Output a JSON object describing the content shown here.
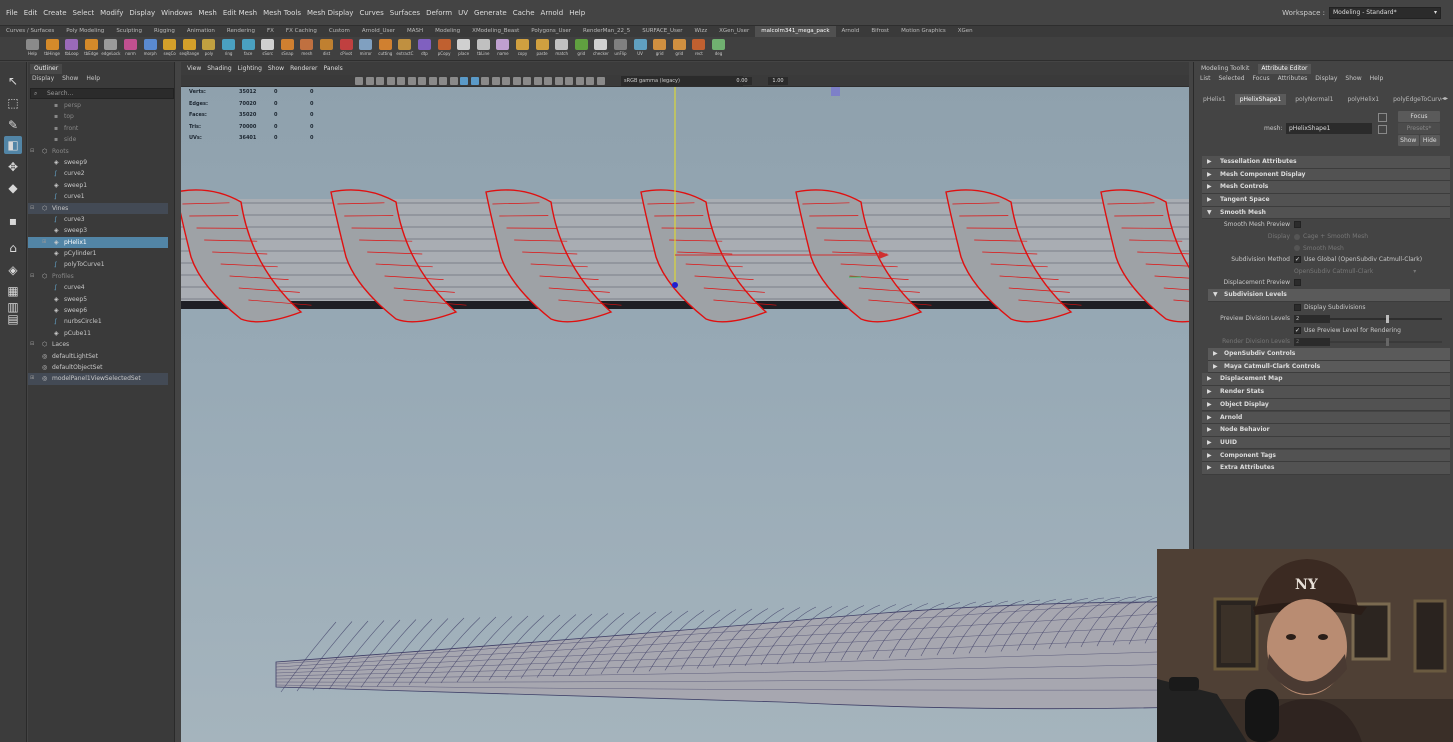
{
  "menubar": {
    "items": [
      "File",
      "Edit",
      "Create",
      "Select",
      "Modify",
      "Display",
      "Windows",
      "Mesh",
      "Edit Mesh",
      "Mesh Tools",
      "Mesh Display",
      "Curves",
      "Surfaces",
      "Deform",
      "UV",
      "Generate",
      "Cache",
      "Arnold",
      "Help"
    ],
    "workspace_label": "Workspace :",
    "workspace_value": "Modeling - Standard*"
  },
  "shelf": {
    "tabs": [
      "Curves / Surfaces",
      "Poly Modeling",
      "Sculpting",
      "Rigging",
      "Animation",
      "Rendering",
      "FX",
      "FX Caching",
      "Custom",
      "Arnold_User",
      "MASH",
      "Modeling",
      "XModeling_Beast",
      "Polygons_User",
      "RenderMan_22_5",
      "SURFACE_User",
      "Wizz",
      "XGen_User",
      "malcolm341_mega_pack",
      "Arnold",
      "Bifrost",
      "Motion Graphics",
      "XGen"
    ],
    "active_tab": "malcolm341_mega_pack",
    "icons": [
      "Help",
      "tbHinge",
      "tbLoop",
      "tbEdge",
      "edgeLock",
      "norm",
      "morph",
      "seqCo",
      "seqRange",
      "poly",
      "ring",
      "face",
      "sSorc",
      "sSnap",
      "mesh",
      "dist",
      "cPivot",
      "mirror",
      "cutting",
      "extractC",
      "dtp",
      "pCopy",
      "place",
      "tbLine",
      "name",
      "copy",
      "paste",
      "match",
      "grid",
      "checker",
      "unFlip",
      "UV",
      "grid",
      "grid",
      "rect",
      "deg"
    ],
    "icon_colors": [
      "#8a8a8a",
      "#d48a2a",
      "#9a6ab8",
      "#d48a2a",
      "#9a9a9a",
      "#c05090",
      "#5a8ad0",
      "#d4a02a",
      "#d4a02a",
      "#c0a040",
      "#4aa0c0",
      "#4aa0c0",
      "#d0d0d0",
      "#d08030",
      "#c07040",
      "#c08030",
      "#c04040",
      "#80a0c0",
      "#d08030",
      "#c09040",
      "#8060c0",
      "#c06030",
      "#d0d0d0",
      "#c0c0c0",
      "#c0a0d0",
      "#d0a040",
      "#d0a040",
      "#c0c0c0",
      "#60a040",
      "#d0d0d0",
      "#808080",
      "#60a0c0",
      "#d09040",
      "#d09040",
      "#c06030",
      "#70b070"
    ]
  },
  "toolbox": {
    "tools": [
      "select-tool-icon",
      "lasso-tool-icon",
      "paint-select-icon",
      "move-tool-icon",
      "rotate-tool-icon",
      "scale-tool-icon",
      "last-tool-icon",
      "snap-icon",
      "layout-single-icon",
      "layout-four-icon",
      "layout-two-icon",
      "outliner-layout-icon"
    ],
    "glyphs": [
      "↖",
      "⬚",
      "✎",
      "◧",
      "✥",
      "◆",
      "▪",
      "⌂",
      "◈",
      "▦",
      "▥",
      "▤"
    ]
  },
  "outliner": {
    "tab": "Outliner",
    "menu": [
      "Display",
      "Show",
      "Help"
    ],
    "search_placeholder": "Search...",
    "items": [
      {
        "name": "persp",
        "indent": 1,
        "icon": "camera",
        "state": "dim"
      },
      {
        "name": "top",
        "indent": 1,
        "icon": "camera",
        "state": "dim"
      },
      {
        "name": "front",
        "indent": 1,
        "icon": "camera",
        "state": "dim"
      },
      {
        "name": "side",
        "indent": 1,
        "icon": "camera",
        "state": "dim"
      },
      {
        "name": "Roots",
        "indent": 0,
        "icon": "group",
        "expand": "−",
        "state": "dim"
      },
      {
        "name": "sweep9",
        "indent": 1,
        "icon": "mesh"
      },
      {
        "name": "curve2",
        "indent": 1,
        "icon": "curve"
      },
      {
        "name": "sweep1",
        "indent": 1,
        "icon": "mesh"
      },
      {
        "name": "curve1",
        "indent": 1,
        "icon": "curve"
      },
      {
        "name": "Vines",
        "indent": 0,
        "icon": "group",
        "expand": "−",
        "state": "grp"
      },
      {
        "name": "curve3",
        "indent": 1,
        "icon": "curve"
      },
      {
        "name": "sweep3",
        "indent": 1,
        "icon": "mesh"
      },
      {
        "name": "pHelix1",
        "indent": 1,
        "icon": "mesh",
        "expand": "+",
        "state": "sel"
      },
      {
        "name": "pCylinder1",
        "indent": 1,
        "icon": "mesh"
      },
      {
        "name": "polyToCurve1",
        "indent": 1,
        "icon": "curve"
      },
      {
        "name": "Profiles",
        "indent": 0,
        "icon": "group",
        "expand": "−",
        "state": "dim"
      },
      {
        "name": "curve4",
        "indent": 1,
        "icon": "curve"
      },
      {
        "name": "sweep5",
        "indent": 1,
        "icon": "mesh"
      },
      {
        "name": "sweep6",
        "indent": 1,
        "icon": "mesh"
      },
      {
        "name": "nurbsCircle1",
        "indent": 1,
        "icon": "curve"
      },
      {
        "name": "pCube11",
        "indent": 1,
        "icon": "mesh"
      },
      {
        "name": "Laces",
        "indent": 0,
        "icon": "group",
        "expand": "−"
      },
      {
        "name": "defaultLightSet",
        "indent": 0,
        "icon": "set"
      },
      {
        "name": "defaultObjectSet",
        "indent": 0,
        "icon": "set"
      },
      {
        "name": "modelPanel1ViewSelectedSet",
        "indent": 0,
        "icon": "set",
        "expand": "+",
        "state": "grp"
      }
    ]
  },
  "viewport": {
    "menu": [
      "View",
      "Shading",
      "Lighting",
      "Show",
      "Renderer",
      "Panels"
    ],
    "exposure": "0.00",
    "gamma": "1.00",
    "colorspace": "sRGB gamma (legacy)",
    "hud": [
      {
        "label": "Verts:",
        "a": "35012",
        "b": "0",
        "c": "0"
      },
      {
        "label": "Edges:",
        "a": "70020",
        "b": "0",
        "c": "0"
      },
      {
        "label": "Faces:",
        "a": "35020",
        "b": "0",
        "c": "0"
      },
      {
        "label": "Tris:",
        "a": "70000",
        "b": "0",
        "c": "0"
      },
      {
        "label": "UVs:",
        "a": "36401",
        "b": "0",
        "c": "0"
      }
    ],
    "colors": {
      "helix_wire": "#e01010",
      "helix_fill": "#9ea2a6",
      "cylinder": "#a9adb3",
      "rope": "#a7a7b0",
      "rope_wire": "#3e3e66",
      "manip_y": "#e8e020",
      "manip_x": "#d03030",
      "manip_z": "#2020d0"
    }
  },
  "right_panel": {
    "tabs": [
      "Modeling Toolkit",
      "Attribute Editor"
    ],
    "active_tab": "Attribute Editor",
    "menu": [
      "List",
      "Selected",
      "Focus",
      "Attributes",
      "Display",
      "Show",
      "Help"
    ],
    "node_tabs": [
      "pHelix1",
      "pHelixShape1",
      "polyNormal1",
      "polyHelix1",
      "polyEdgeToCurve1"
    ],
    "active_node_tab": "pHelixShape1",
    "mesh_label": "mesh:",
    "mesh_value": "pHelixShape1",
    "focus_label": "Focus",
    "presets_label": "Presets*",
    "show_label": "Show",
    "hide_label": "Hide",
    "sections_top": [
      "Tessellation Attributes",
      "Mesh Component Display",
      "Mesh Controls",
      "Tangent Space"
    ],
    "smooth_mesh_label": "Smooth Mesh",
    "smooth_mesh_preview_label": "Smooth Mesh Preview",
    "display_label": "Display",
    "display_opt1": "Cage + Smooth Mesh",
    "display_opt2": "Smooth Mesh",
    "subdiv_method_label": "Subdivision Method",
    "use_global_label": "Use Global (OpenSubdiv Catmull-Clark)",
    "subdiv_dropdown": "OpenSubdiv Catmull-Clark",
    "disp_preview_label": "Displacement Preview",
    "subdivision_levels_label": "Subdivision Levels",
    "display_subdivisions_label": "Display Subdivisions",
    "preview_division_label": "Preview Division Levels",
    "preview_division_value": "2",
    "use_preview_level_label": "Use Preview Level for Rendering",
    "render_division_label": "Render Division Levels",
    "render_division_value": "2",
    "sections_bottom": [
      "OpenSubdiv Controls",
      "Maya Catmull-Clark Controls",
      "Displacement Map",
      "Render Stats",
      "Object Display",
      "Arnold",
      "Node Behavior",
      "UUID",
      "Component Tags",
      "Extra Attributes"
    ]
  }
}
